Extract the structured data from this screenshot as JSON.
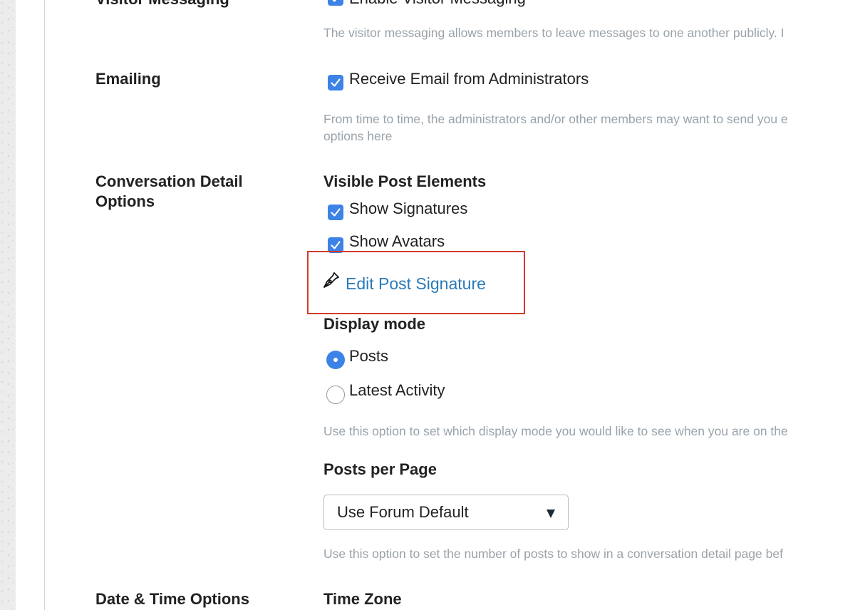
{
  "sections": {
    "visitor_messaging": {
      "label": "Visitor Messaging",
      "option": "Enable Visitor Messaging",
      "help": "The visitor messaging allows members to leave messages to one another publicly. I"
    },
    "emailing": {
      "label": "Emailing",
      "option": "Receive Email from Administrators",
      "help_line1": "From time to time, the administrators and/or other members may want to send you e",
      "help_line2": "options here"
    },
    "conversation": {
      "label_line1": "Conversation Detail",
      "label_line2": "Options",
      "visible_post_elements": "Visible Post Elements",
      "show_signatures": "Show Signatures",
      "show_avatars": "Show Avatars",
      "edit_signature_link": "Edit Post Signature",
      "display_mode": "Display mode",
      "mode_posts": "Posts",
      "mode_latest": "Latest Activity",
      "display_mode_help": "Use this option to set which display mode you would like to see when you are on the",
      "posts_per_page": "Posts per Page",
      "posts_per_page_value": "Use Forum Default",
      "posts_per_page_help": "Use this option to set the number of posts to show in a conversation detail page bef"
    },
    "date_time": {
      "label": "Date & Time Options",
      "time_zone": "Time Zone"
    }
  },
  "state": {
    "visitor_messaging_checked": true,
    "emailing_checked": true,
    "show_signatures_checked": true,
    "show_avatars_checked": true,
    "display_mode_selected": "Posts"
  },
  "colors": {
    "accent": "#3d82e6",
    "link": "#2a7ab8",
    "help_text": "#9aa3aa",
    "highlight_border": "#d23a2c"
  },
  "icons": {
    "edit_signature": "pen-nib-icon",
    "checkbox": "check-icon",
    "select_arrow": "caret-down-icon"
  }
}
